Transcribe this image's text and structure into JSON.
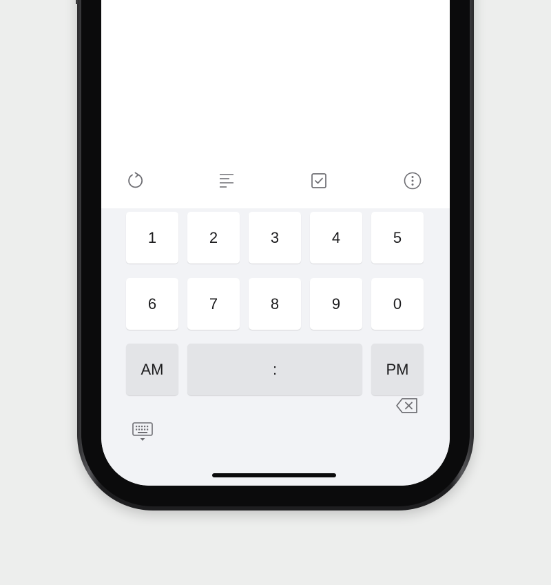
{
  "toolbar": {
    "items": [
      {
        "icon": "refresh-icon"
      },
      {
        "icon": "text-align-icon"
      },
      {
        "icon": "checkbox-icon"
      },
      {
        "icon": "more-icon"
      }
    ]
  },
  "keypad": {
    "row1": [
      "1",
      "2",
      "3",
      "4",
      "5"
    ],
    "row2": [
      "6",
      "7",
      "8",
      "9",
      "0"
    ],
    "am_label": "AM",
    "colon_label": ":",
    "pm_label": "PM"
  },
  "bottom_bar": {
    "left_icon": "keyboard-hide-icon",
    "right_icon": "backspace-icon"
  },
  "colors": {
    "background": "#edeeed",
    "screen": "#ffffff",
    "keyboard": "#f2f3f6",
    "key": "#ffffff",
    "function_key": "#e3e4e7",
    "icon": "#6e6e73"
  }
}
